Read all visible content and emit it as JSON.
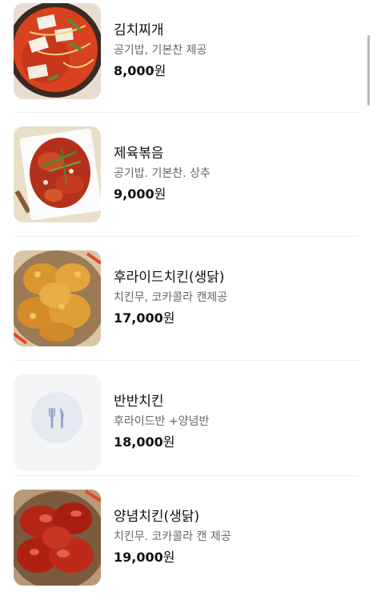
{
  "currency_suffix": "원",
  "menu": {
    "items": [
      {
        "name": "김치찌개",
        "description": "공기밥, 기본찬 제공",
        "price": "8,000",
        "image": "kimchi-stew-photo"
      },
      {
        "name": "제육볶음",
        "description": "공기밥. 기본찬. 상추",
        "price": "9,000",
        "image": "spicy-pork-photo"
      },
      {
        "name": "후라이드치킨(생닭)",
        "description": "치킨무, 코카콜라 캔제공",
        "price": "17,000",
        "image": "fried-chicken-photo"
      },
      {
        "name": "반반치킨",
        "description": "후라이드반 +양념반",
        "price": "18,000",
        "image": "utensils-placeholder-icon"
      },
      {
        "name": "양념치킨(생닭)",
        "description": "치킨무. 코카콜라 캔 제공",
        "price": "19,000",
        "image": "seasoned-chicken-photo"
      }
    ]
  },
  "colors": {
    "divider": "#eeeeee",
    "placeholder_bg": "#f4f5f7",
    "placeholder_circle": "#e6e9ef",
    "placeholder_icon": "#8fa3cc"
  }
}
